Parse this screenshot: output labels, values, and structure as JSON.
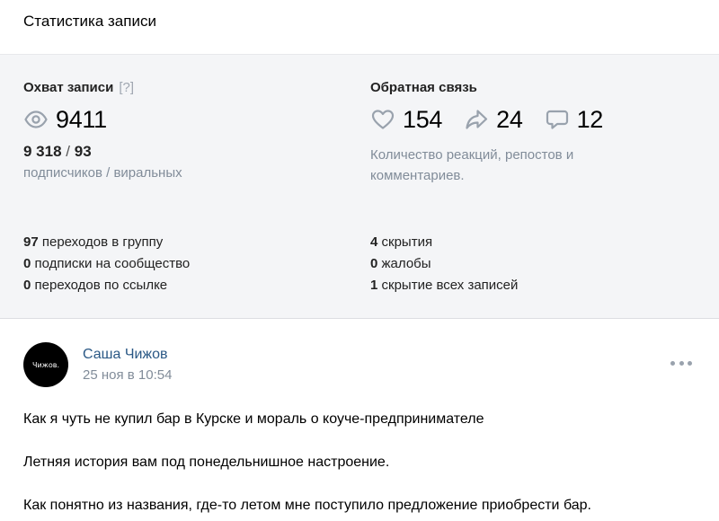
{
  "header": {
    "title": "Статистика записи"
  },
  "reach": {
    "title": "Охват записи",
    "help": "[?]",
    "views": "9411",
    "subscribers": "9 318",
    "separator": "/",
    "viral": "93",
    "caption": "подписчиков / виральных"
  },
  "feedback": {
    "title": "Обратная связь",
    "likes": "154",
    "reposts": "24",
    "comments": "12",
    "caption": "Количество реакций, репостов и комментариев."
  },
  "left_list": [
    {
      "count": "97",
      "label": "переходов в группу"
    },
    {
      "count": "0",
      "label": "подписки на сообщество"
    },
    {
      "count": "0",
      "label": "переходов по ссылке"
    }
  ],
  "right_list": [
    {
      "count": "4",
      "label": "скрытия"
    },
    {
      "count": "0",
      "label": "жалобы"
    },
    {
      "count": "1",
      "label": "скрытие всех записей"
    }
  ],
  "post": {
    "avatar_text": "Чижов.",
    "author": "Саша Чижов",
    "date": "25 ноя в 10:54",
    "lines": [
      "Как я чуть не купил бар в Курске и мораль о коуче-предпринимателе",
      "Летняя история вам под понедельнишное настроение.",
      "Как понятно из названия, где-то летом мне поступило предложение приобрести бар."
    ]
  },
  "colors": {
    "panel_bg": "#f4f5f7",
    "muted_text": "#818c99",
    "link": "#2a5885",
    "icon": "#99a2ad"
  },
  "icons": {
    "views": "eye-icon",
    "likes": "heart-icon",
    "reposts": "share-arrow-icon",
    "comments": "comment-icon",
    "menu": "more-dots-icon"
  }
}
